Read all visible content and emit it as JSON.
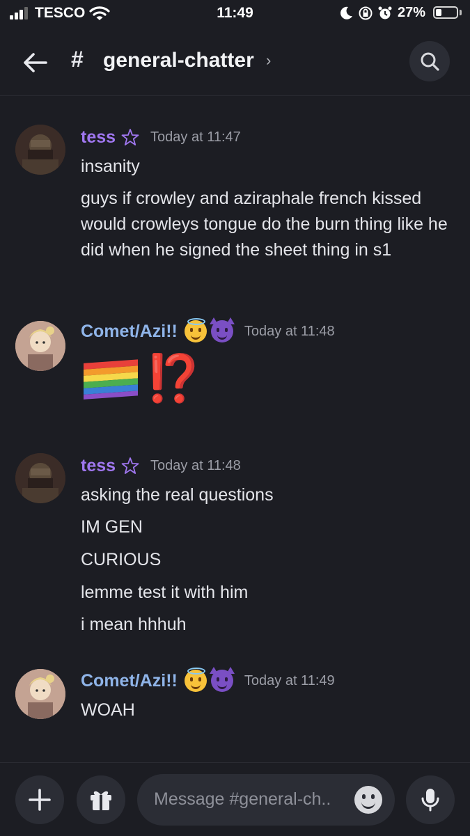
{
  "status_bar": {
    "carrier": "TESCO",
    "time": "11:49",
    "battery": "27%",
    "battery_level": 0.27
  },
  "header": {
    "hash": "#",
    "channel": "general-chatter",
    "chevron": "›"
  },
  "messages": [
    {
      "author": "tess",
      "author_color": "#a077f0",
      "timestamp": "Today at 11:47",
      "lines": [
        "insanity",
        "guys if crowley and aziraphale french kissed would crowleys tongue do the burn thing like he did when he signed the sheet thing in s1"
      ]
    },
    {
      "author": "Comet/Azi!!",
      "author_color": "#8fb4e8",
      "badges": [
        "smiling-face-with-halo-icon",
        "smiling-face-with-horns-icon"
      ],
      "timestamp": "Today at 11:48",
      "emoji": "rainbow-flag-icon",
      "emoji_text": "⁉️"
    },
    {
      "author": "tess",
      "author_color": "#a077f0",
      "timestamp": "Today at 11:48",
      "lines": [
        "asking the real questions",
        "IM GEN",
        "CURIOUS",
        "lemme test it with him",
        "i mean hhhuh"
      ]
    },
    {
      "author": "Comet/Azi!!",
      "author_color": "#8fb4e8",
      "badges": [
        "smiling-face-with-halo-icon",
        "smiling-face-with-horns-icon"
      ],
      "timestamp": "Today at 11:49",
      "lines": [
        "WOAH"
      ]
    }
  ],
  "composer": {
    "placeholder": "Message #general-ch.."
  }
}
